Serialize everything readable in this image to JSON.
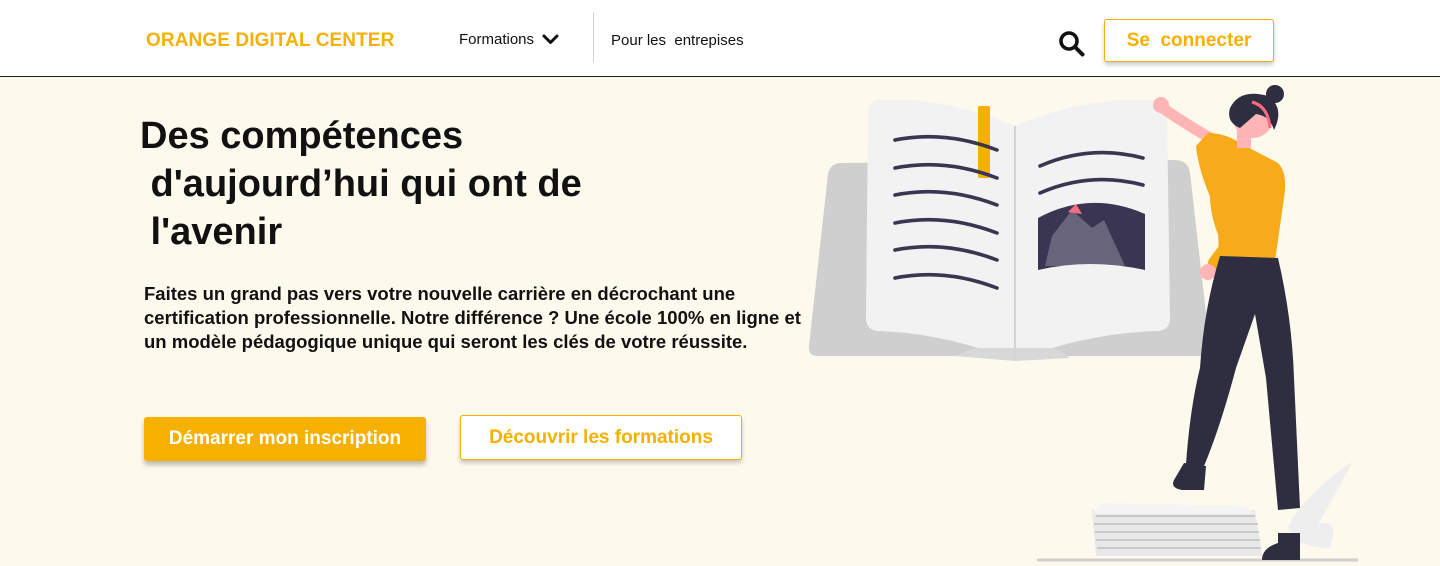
{
  "nav": {
    "brand": "ORANGE DIGITAL CENTER",
    "formations_label": "Formations",
    "entreprises_label": "Pour les  entrepises",
    "login_label": "Se  connecter"
  },
  "hero": {
    "title": "Des compétences\n d'aujourd’hui qui ont de\n l'avenir",
    "description": "Faites un grand pas vers votre nouvelle carrière en décrochant une certification professionnelle. Notre différence ? Une école 100% en ligne et un modèle pédagogique unique qui seront les clés de votre réussite.",
    "primary_button": "Démarrer mon inscription",
    "secondary_button": "Découvrir les formations"
  },
  "icons": {
    "dropdown": "chevron-down-icon",
    "search": "search-icon"
  },
  "colors": {
    "brand": "#f6b000",
    "hero_background": "#fdf9ec",
    "text": "#111111"
  }
}
